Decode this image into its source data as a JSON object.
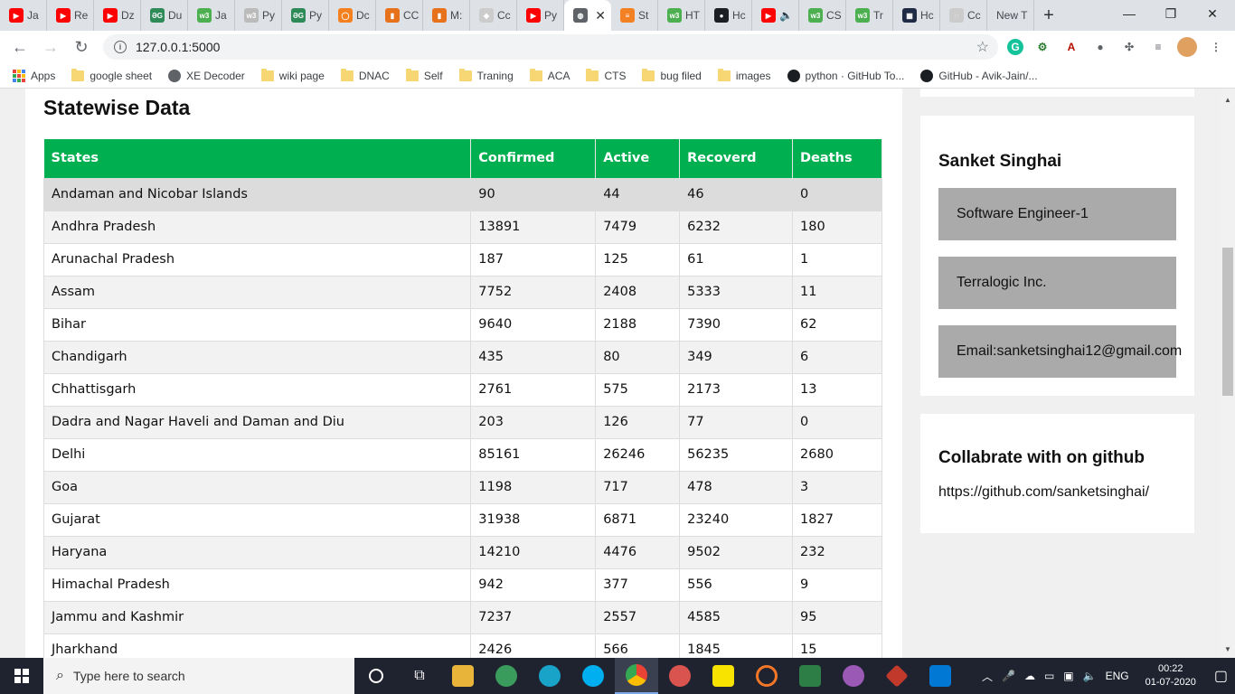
{
  "browser": {
    "tabs": [
      {
        "label": "Ja",
        "color": "#ff0000",
        "glyph": "▶"
      },
      {
        "label": "Re",
        "color": "#ff0000",
        "glyph": "▶"
      },
      {
        "label": "Dz",
        "color": "#ff0000",
        "glyph": "▶"
      },
      {
        "label": "Du",
        "color": "#2e8b57",
        "glyph": "ƏG"
      },
      {
        "label": "Ja",
        "color": "#4caf50",
        "glyph": "w3"
      },
      {
        "label": "Py",
        "color": "#bbbbbb",
        "glyph": "w3"
      },
      {
        "label": "Py",
        "color": "#2e8b57",
        "glyph": "ƏG"
      },
      {
        "label": "Dc",
        "color": "#f4801f",
        "glyph": "◯"
      },
      {
        "label": "CC",
        "color": "#e8711b",
        "glyph": "▮"
      },
      {
        "label": "M:",
        "color": "#e8711b",
        "glyph": "▮"
      },
      {
        "label": "Cc",
        "color": "#cccccc",
        "glyph": "◆"
      },
      {
        "label": "Py",
        "color": "#ff0000",
        "glyph": "▶"
      },
      {
        "label": "",
        "color": "#5f6368",
        "glyph": "◍",
        "active": true
      },
      {
        "label": "St",
        "color": "#f48024",
        "glyph": "≡"
      },
      {
        "label": "HT",
        "color": "#4caf50",
        "glyph": "w3"
      },
      {
        "label": "Hc",
        "color": "#1b1f23",
        "glyph": "●"
      },
      {
        "label": "🔈",
        "color": "#ff0000",
        "glyph": "▶"
      },
      {
        "label": "CS",
        "color": "#4caf50",
        "glyph": "w3"
      },
      {
        "label": "Tr",
        "color": "#4caf50",
        "glyph": "w3"
      },
      {
        "label": "Hc",
        "color": "#1f2a44",
        "glyph": "▦"
      },
      {
        "label": "Cc",
        "color": "#cccccc",
        "glyph": "◌"
      },
      {
        "label": "New T",
        "color": "",
        "glyph": ""
      }
    ],
    "url": "127.0.0.1:5000",
    "bookmarks": [
      {
        "label": "Apps",
        "icon": "apps"
      },
      {
        "label": "google sheet",
        "icon": "folder"
      },
      {
        "label": "XE Decoder",
        "icon": "globe"
      },
      {
        "label": "wiki page",
        "icon": "folder"
      },
      {
        "label": "DNAC",
        "icon": "folder"
      },
      {
        "label": "Self",
        "icon": "folder"
      },
      {
        "label": "Traning",
        "icon": "folder"
      },
      {
        "label": "ACA",
        "icon": "folder"
      },
      {
        "label": "CTS",
        "icon": "folder"
      },
      {
        "label": "bug filed",
        "icon": "folder"
      },
      {
        "label": "images",
        "icon": "folder"
      },
      {
        "label": "python · GitHub To...",
        "icon": "github"
      },
      {
        "label": "GitHub - Avik-Jain/...",
        "icon": "github"
      }
    ]
  },
  "page": {
    "title": "Statewise Data",
    "table": {
      "headers": [
        "States",
        "Confirmed",
        "Active",
        "Recoverd",
        "Deaths"
      ],
      "rows": [
        [
          "Andaman and Nicobar Islands",
          "90",
          "44",
          "46",
          "0"
        ],
        [
          "Andhra Pradesh",
          "13891",
          "7479",
          "6232",
          "180"
        ],
        [
          "Arunachal Pradesh",
          "187",
          "125",
          "61",
          "1"
        ],
        [
          "Assam",
          "7752",
          "2408",
          "5333",
          "11"
        ],
        [
          "Bihar",
          "9640",
          "2188",
          "7390",
          "62"
        ],
        [
          "Chandigarh",
          "435",
          "80",
          "349",
          "6"
        ],
        [
          "Chhattisgarh",
          "2761",
          "575",
          "2173",
          "13"
        ],
        [
          "Dadra and Nagar Haveli and Daman and Diu",
          "203",
          "126",
          "77",
          "0"
        ],
        [
          "Delhi",
          "85161",
          "26246",
          "56235",
          "2680"
        ],
        [
          "Goa",
          "1198",
          "717",
          "478",
          "3"
        ],
        [
          "Gujarat",
          "31938",
          "6871",
          "23240",
          "1827"
        ],
        [
          "Haryana",
          "14210",
          "4476",
          "9502",
          "232"
        ],
        [
          "Himachal Pradesh",
          "942",
          "377",
          "556",
          "9"
        ],
        [
          "Jammu and Kashmir",
          "7237",
          "2557",
          "4585",
          "95"
        ],
        [
          "Jharkhand",
          "2426",
          "566",
          "1845",
          "15"
        ]
      ]
    },
    "profile": {
      "name": "Sanket Singhai",
      "role": "Software Engineer-1",
      "company": "Terralogic Inc.",
      "email": "Email:sanketsinghai12@gmail.com"
    },
    "github": {
      "title": "Collabrate with on github",
      "link": "https://github.com/sanketsinghai/"
    }
  },
  "taskbar": {
    "search_placeholder": "Type here to search",
    "language": "ENG",
    "time": "00:22",
    "date": "01-07-2020"
  },
  "colors": {
    "table_header": "#00b050",
    "info_box": "#aaaaaa"
  }
}
